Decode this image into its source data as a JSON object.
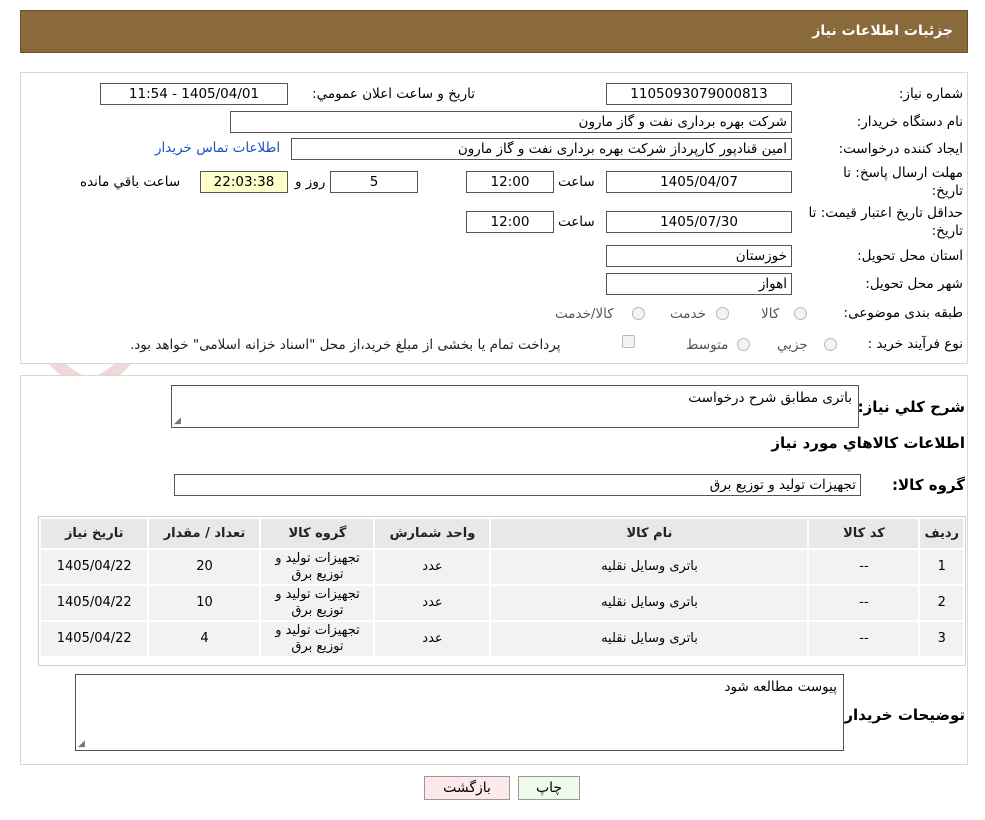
{
  "header": {
    "title": "جزئیات اطلاعات نیاز"
  },
  "watermark": {
    "text": "AriaTender.neT"
  },
  "form": {
    "need_number": {
      "label": "شماره نیاز:",
      "value": "1105093079000813"
    },
    "announce_datetime": {
      "label": "تاریخ و ساعت اعلان عمومي:",
      "value": "1405/04/01 - 11:54"
    },
    "buyer_org": {
      "label": "نام دستگاه خریدار:",
      "value": "شرکت بهره برداری نفت و گاز مارون"
    },
    "requester": {
      "label": "ایجاد کننده درخواست:",
      "value": "امین قنادپور کارپرداز شرکت بهره برداری نفت و گاز مارون",
      "contact_link": "اطلاعات تماس خریدار"
    },
    "reply_deadline": {
      "label_line1": "مهلت ارسال پاسخ: تا",
      "label_line2": "تاریخ:",
      "date": "1405/04/07",
      "time_label": "ساعت",
      "time": "12:00",
      "days": "5",
      "days_label": "روز و",
      "remaining": "22:03:38",
      "remaining_label": "ساعت باقي مانده"
    },
    "price_validity": {
      "label_line1": "حداقل تاریخ اعتبار قیمت: تا",
      "label_line2": "تاریخ:",
      "date": "1405/07/30",
      "time_label": "ساعت",
      "time": "12:00"
    },
    "province": {
      "label": "استان محل تحویل:",
      "value": "خوزستان"
    },
    "city": {
      "label": "شهر محل تحویل:",
      "value": "اهواز"
    },
    "category": {
      "label": "طبقه بندی موضوعی:",
      "options": [
        "کالا",
        "خدمت",
        "کالا/خدمت"
      ]
    },
    "process": {
      "label": "نوع فرآیند خرید :",
      "options": [
        "جزیي",
        "متوسط"
      ],
      "payment_note": "پرداخت تمام یا بخشی از مبلغ خرید،از محل \"اسناد خزانه اسلامی\" خواهد بود."
    }
  },
  "details": {
    "summary_label": "شرح کلي نیاز:",
    "summary_value": "باتری مطابق شرح درخواست",
    "goods_info_title": "اطلاعات کالاهاي مورد نیاز",
    "goods_group_label": "گروه کالا:",
    "goods_group_value": "تجهیزات تولید و توزیع برق",
    "table": {
      "headers": [
        "ردیف",
        "کد کالا",
        "نام کالا",
        "واحد شمارش",
        "گروه کالا",
        "تعداد / مقدار",
        "تاریخ نیاز"
      ],
      "rows": [
        [
          "1",
          "--",
          "باتری وسایل نقلیه",
          "عدد",
          "تجهیزات تولید و توزیع برق",
          "20",
          "1405/04/22"
        ],
        [
          "2",
          "--",
          "باتری وسایل نقلیه",
          "عدد",
          "تجهیزات تولید و توزیع برق",
          "10",
          "1405/04/22"
        ],
        [
          "3",
          "--",
          "باتری وسایل نقلیه",
          "عدد",
          "تجهیزات تولید و توزیع برق",
          "4",
          "1405/04/22"
        ]
      ]
    },
    "buyer_notes_label": "توضیحات خریدار:",
    "buyer_notes_value": "پیوست مطالعه شود"
  },
  "buttons": {
    "print": "چاپ",
    "back": "بازگشت"
  },
  "colors": {
    "header_bg": "#8a6a3a",
    "link": "#1a4fc4",
    "back_button_bg": "#fde9ea",
    "print_button_bg": "#eefbe8"
  }
}
